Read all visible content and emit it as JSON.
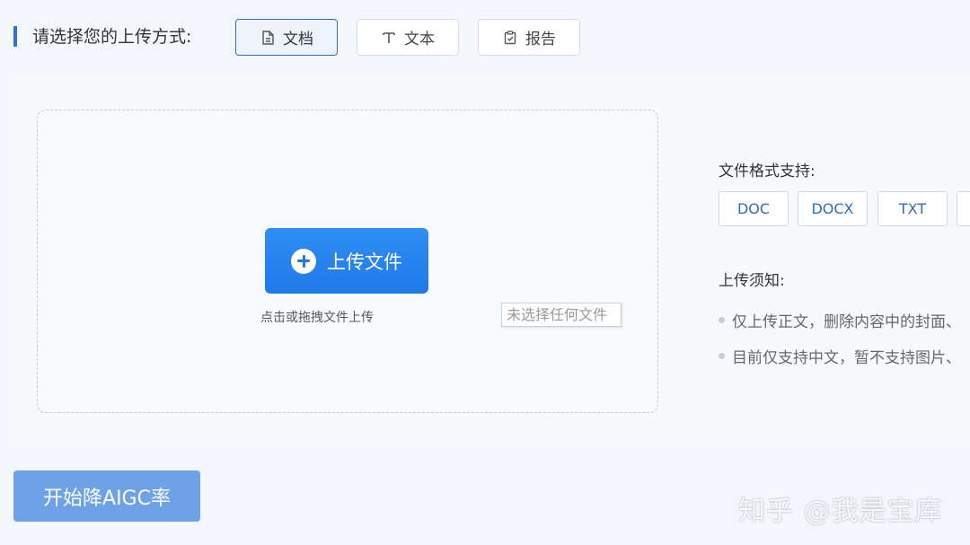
{
  "header": {
    "label": "请选择您的上传方式:",
    "modes": [
      {
        "label": "文档",
        "icon": "document-icon",
        "active": true
      },
      {
        "label": "文本",
        "icon": "text-icon",
        "active": false
      },
      {
        "label": "报告",
        "icon": "clipboard-check-icon",
        "active": false
      }
    ]
  },
  "upload": {
    "button_label": "上传文件",
    "button_icon": "plus-circle-icon",
    "hint": "点击或拖拽文件上传",
    "file_status": "未选择任何文件"
  },
  "formats": {
    "label": "文件格式支持:",
    "items": [
      "DOC",
      "DOCX",
      "TXT"
    ]
  },
  "notice": {
    "label": "上传须知:",
    "items": [
      "仅上传正文，删除内容中的封面、",
      "目前仅支持中文，暂不支持图片、"
    ]
  },
  "actions": {
    "start_label": "开始降AIGC率"
  },
  "watermark": "知乎 @我是宝库",
  "colors": {
    "accent": "#2c6fd6",
    "upload_button": "#1f7ae8",
    "start_button": "#6ea2e6",
    "format_text": "#2f6db7"
  }
}
